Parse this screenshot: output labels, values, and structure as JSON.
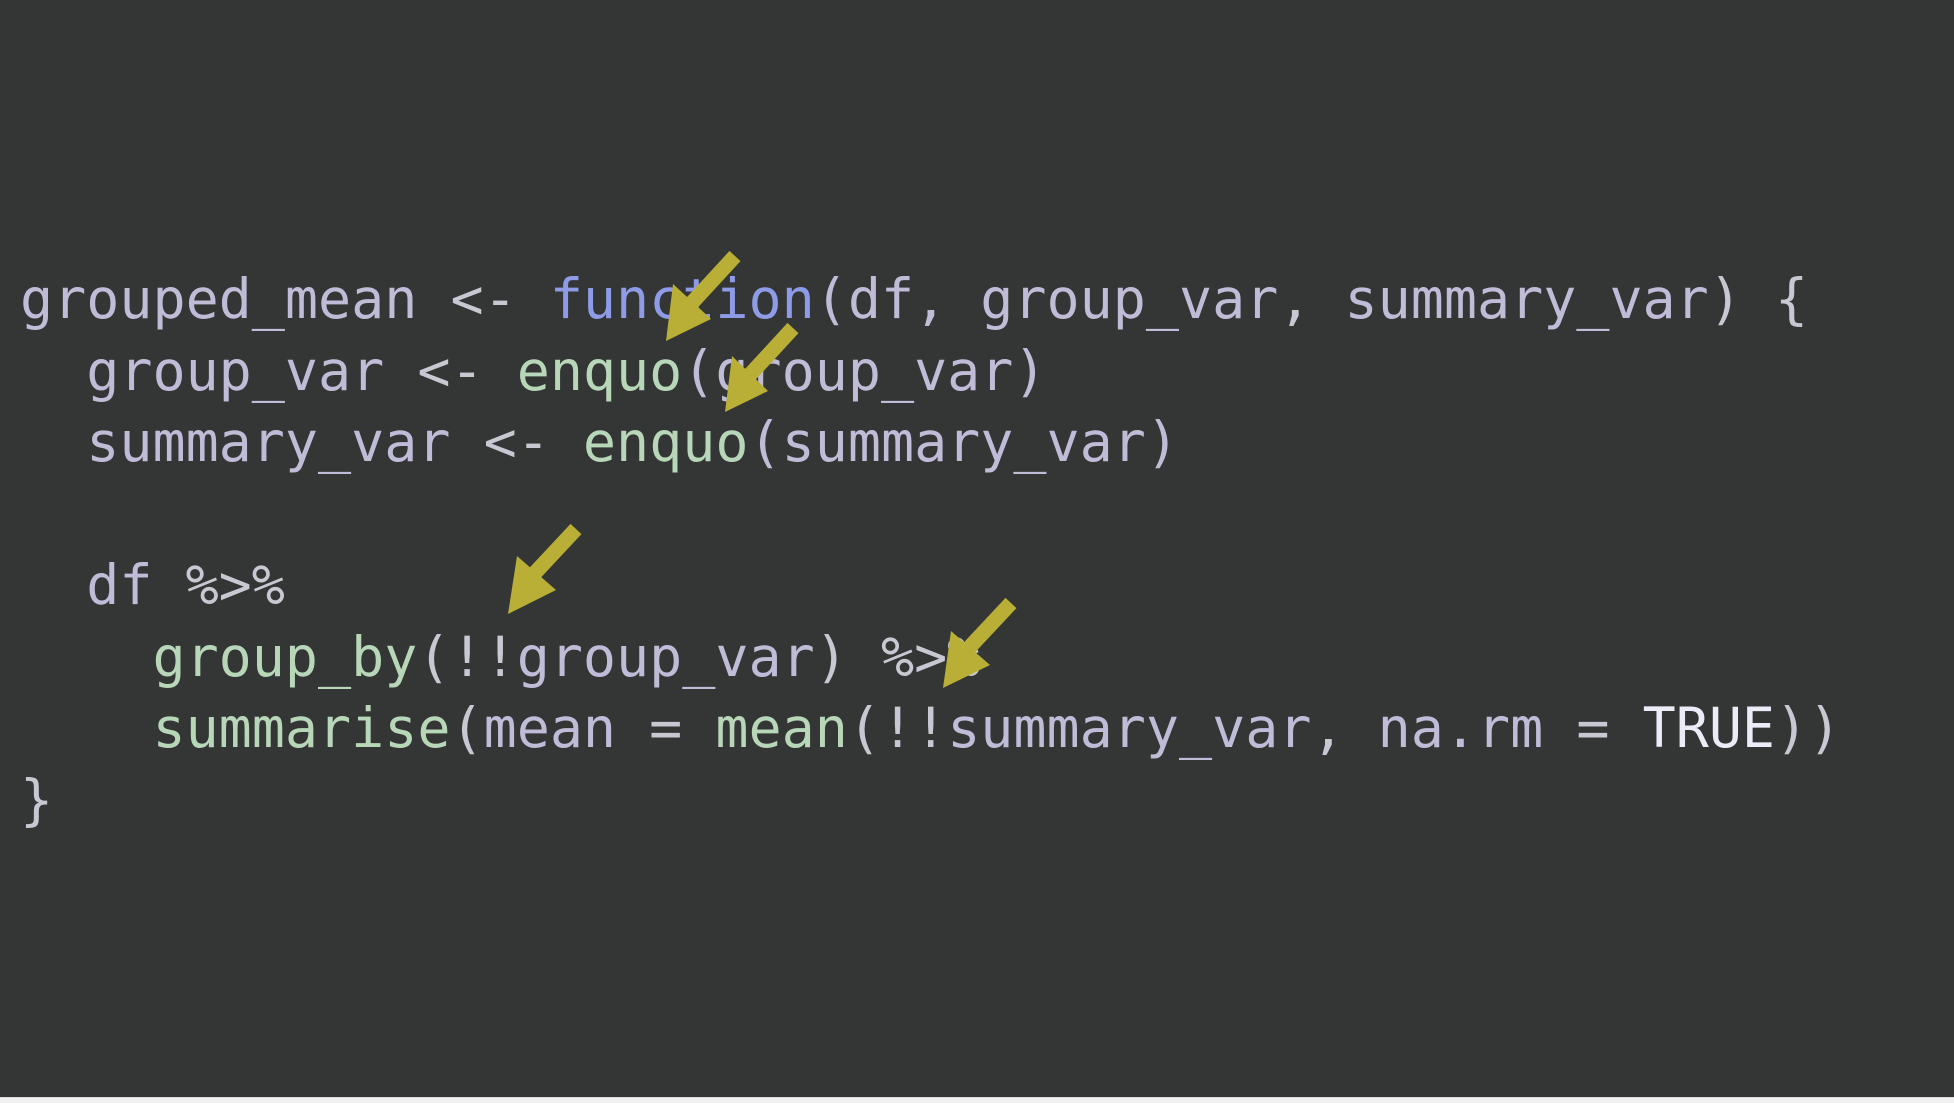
{
  "code": {
    "language": "R",
    "lines": [
      [
        {
          "text": "grouped_mean",
          "kind": "arg"
        },
        {
          "text": " <- ",
          "kind": "op"
        },
        {
          "text": "function",
          "kind": "kw"
        },
        {
          "text": "(df, ",
          "kind": "arg"
        },
        {
          "text": "group_var",
          "kind": "arg"
        },
        {
          "text": ", ",
          "kind": "op"
        },
        {
          "text": "summary_var",
          "kind": "arg"
        },
        {
          "text": ") {",
          "kind": "op"
        }
      ],
      [
        {
          "text": "  group_var",
          "kind": "arg"
        },
        {
          "text": " <- ",
          "kind": "op"
        },
        {
          "text": "enquo",
          "kind": "fn"
        },
        {
          "text": "(group_var)",
          "kind": "arg"
        }
      ],
      [
        {
          "text": "  summary_var",
          "kind": "arg"
        },
        {
          "text": " <- ",
          "kind": "op"
        },
        {
          "text": "enquo",
          "kind": "fn"
        },
        {
          "text": "(summary_var)",
          "kind": "arg"
        }
      ],
      [],
      [
        {
          "text": "  df",
          "kind": "arg"
        },
        {
          "text": " %>%",
          "kind": "op"
        }
      ],
      [
        {
          "text": "    group_by",
          "kind": "fn"
        },
        {
          "text": "(!!",
          "kind": "op"
        },
        {
          "text": "group_var",
          "kind": "arg"
        },
        {
          "text": ")",
          "kind": "op"
        },
        {
          "text": " %>%",
          "kind": "op"
        }
      ],
      [
        {
          "text": "    summarise",
          "kind": "fn"
        },
        {
          "text": "(",
          "kind": "op"
        },
        {
          "text": "mean",
          "kind": "arg"
        },
        {
          "text": " = ",
          "kind": "op"
        },
        {
          "text": "mean",
          "kind": "fn"
        },
        {
          "text": "(!!",
          "kind": "op"
        },
        {
          "text": "summary_var",
          "kind": "arg"
        },
        {
          "text": ", ",
          "kind": "op"
        },
        {
          "text": "na.rm",
          "kind": "arg"
        },
        {
          "text": " = ",
          "kind": "op"
        },
        {
          "text": "TRUE",
          "kind": "const"
        },
        {
          "text": "))",
          "kind": "op"
        }
      ],
      [
        {
          "text": "}",
          "kind": "op"
        }
      ]
    ]
  },
  "annotation": {
    "arrow_color": "#b9ae36",
    "arrow_count": 4
  }
}
